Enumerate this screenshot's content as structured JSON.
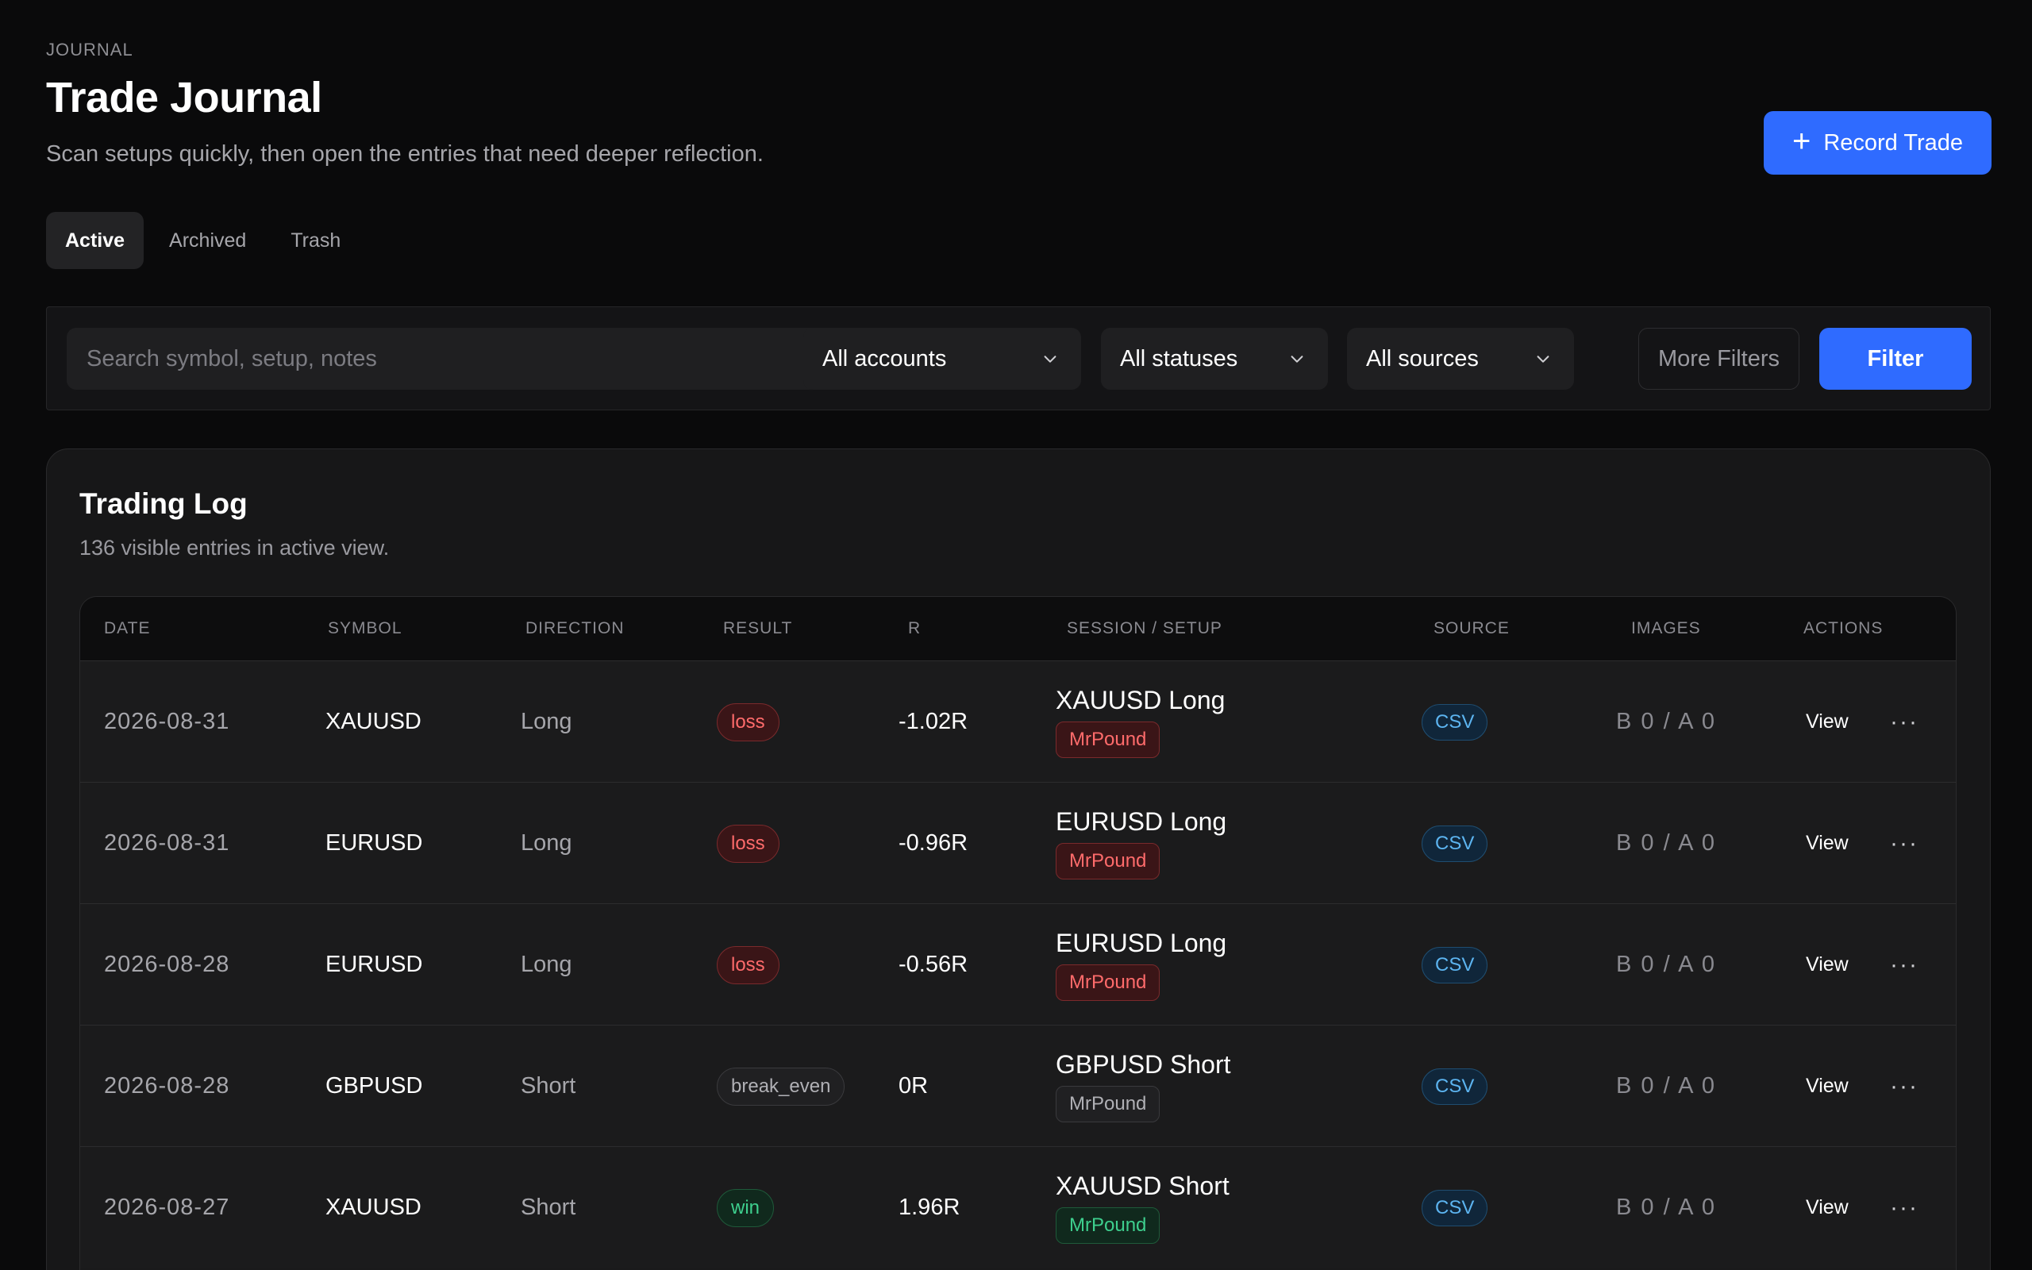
{
  "header": {
    "eyebrow": "JOURNAL",
    "title": "Trade Journal",
    "subtitle": "Scan setups quickly, then open the entries that need deeper reflection.",
    "record_label": "Record Trade"
  },
  "tabs": [
    {
      "label": "Active",
      "active": true
    },
    {
      "label": "Archived",
      "active": false
    },
    {
      "label": "Trash",
      "active": false
    }
  ],
  "filters": {
    "search_placeholder": "Search symbol, setup, notes",
    "accounts": "All accounts",
    "statuses": "All statuses",
    "sources": "All sources",
    "more_filters": "More Filters",
    "filter_label": "Filter"
  },
  "log": {
    "title": "Trading Log",
    "subtitle": "136 visible entries in active view.",
    "columns": [
      "DATE",
      "SYMBOL",
      "DIRECTION",
      "RESULT",
      "R",
      "SESSION / SETUP",
      "SOURCE",
      "IMAGES",
      "ACTIONS"
    ],
    "rows": [
      {
        "date": "2026-08-31",
        "symbol": "XAUUSD",
        "direction": "Long",
        "result": "loss",
        "r": "-1.02R",
        "setup": "XAUUSD Long",
        "tag": "MrPound",
        "source": "CSV",
        "images": "B 0 / A 0",
        "view": "View"
      },
      {
        "date": "2026-08-31",
        "symbol": "EURUSD",
        "direction": "Long",
        "result": "loss",
        "r": "-0.96R",
        "setup": "EURUSD Long",
        "tag": "MrPound",
        "source": "CSV",
        "images": "B 0 / A 0",
        "view": "View"
      },
      {
        "date": "2026-08-28",
        "symbol": "EURUSD",
        "direction": "Long",
        "result": "loss",
        "r": "-0.56R",
        "setup": "EURUSD Long",
        "tag": "MrPound",
        "source": "CSV",
        "images": "B 0 / A 0",
        "view": "View"
      },
      {
        "date": "2026-08-28",
        "symbol": "GBPUSD",
        "direction": "Short",
        "result": "break_even",
        "r": "0R",
        "setup": "GBPUSD Short",
        "tag": "MrPound",
        "source": "CSV",
        "images": "B 0 / A 0",
        "view": "View"
      },
      {
        "date": "2026-08-27",
        "symbol": "XAUUSD",
        "direction": "Short",
        "result": "win",
        "r": "1.96R",
        "setup": "XAUUSD Short",
        "tag": "MrPound",
        "source": "CSV",
        "images": "B 0 / A 0",
        "view": "View"
      }
    ]
  },
  "colors": {
    "accent": "#2f6bff",
    "loss": "#ff6b6b",
    "win": "#3ecf8e",
    "source": "#5cb4f0"
  }
}
